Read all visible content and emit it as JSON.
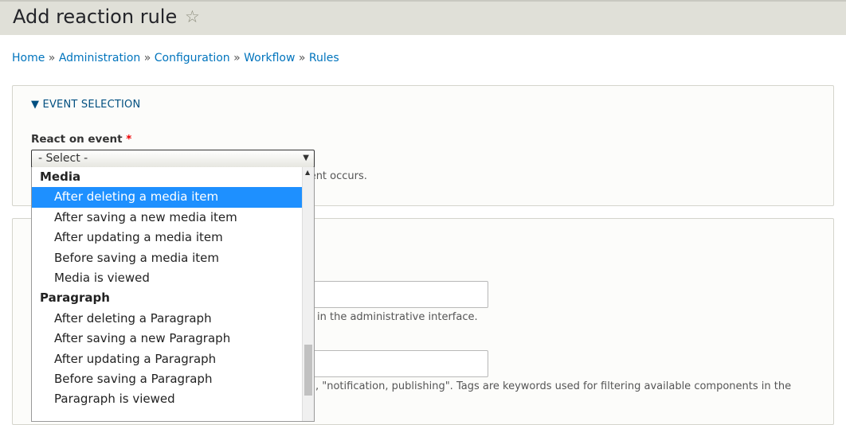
{
  "page": {
    "title": "Add reaction rule"
  },
  "breadcrumb": [
    "Home",
    "Administration",
    "Configuration",
    "Workflow",
    "Rules"
  ],
  "event_selection": {
    "legend": "EVENT SELECTION",
    "label": "React on event",
    "required_mark": "*",
    "select_value": "- Select -",
    "description_visible": "vent occurs."
  },
  "settings": {
    "label_description_visible": "in the administrative interface.",
    "tags_description_visible": ", \"notification, publishing\". Tags are keywords used for filtering available components in the"
  },
  "dropdown": {
    "options": [
      {
        "label": "Media",
        "group": true
      },
      {
        "label": "After deleting a media item",
        "selected": true
      },
      {
        "label": "After saving a new media item"
      },
      {
        "label": "After updating a media item"
      },
      {
        "label": "Before saving a media item"
      },
      {
        "label": "Media is viewed"
      },
      {
        "label": "Paragraph",
        "group": true
      },
      {
        "label": "After deleting a Paragraph"
      },
      {
        "label": "After saving a new Paragraph"
      },
      {
        "label": "After updating a Paragraph"
      },
      {
        "label": "Before saving a Paragraph"
      },
      {
        "label": "Paragraph is viewed"
      }
    ]
  }
}
